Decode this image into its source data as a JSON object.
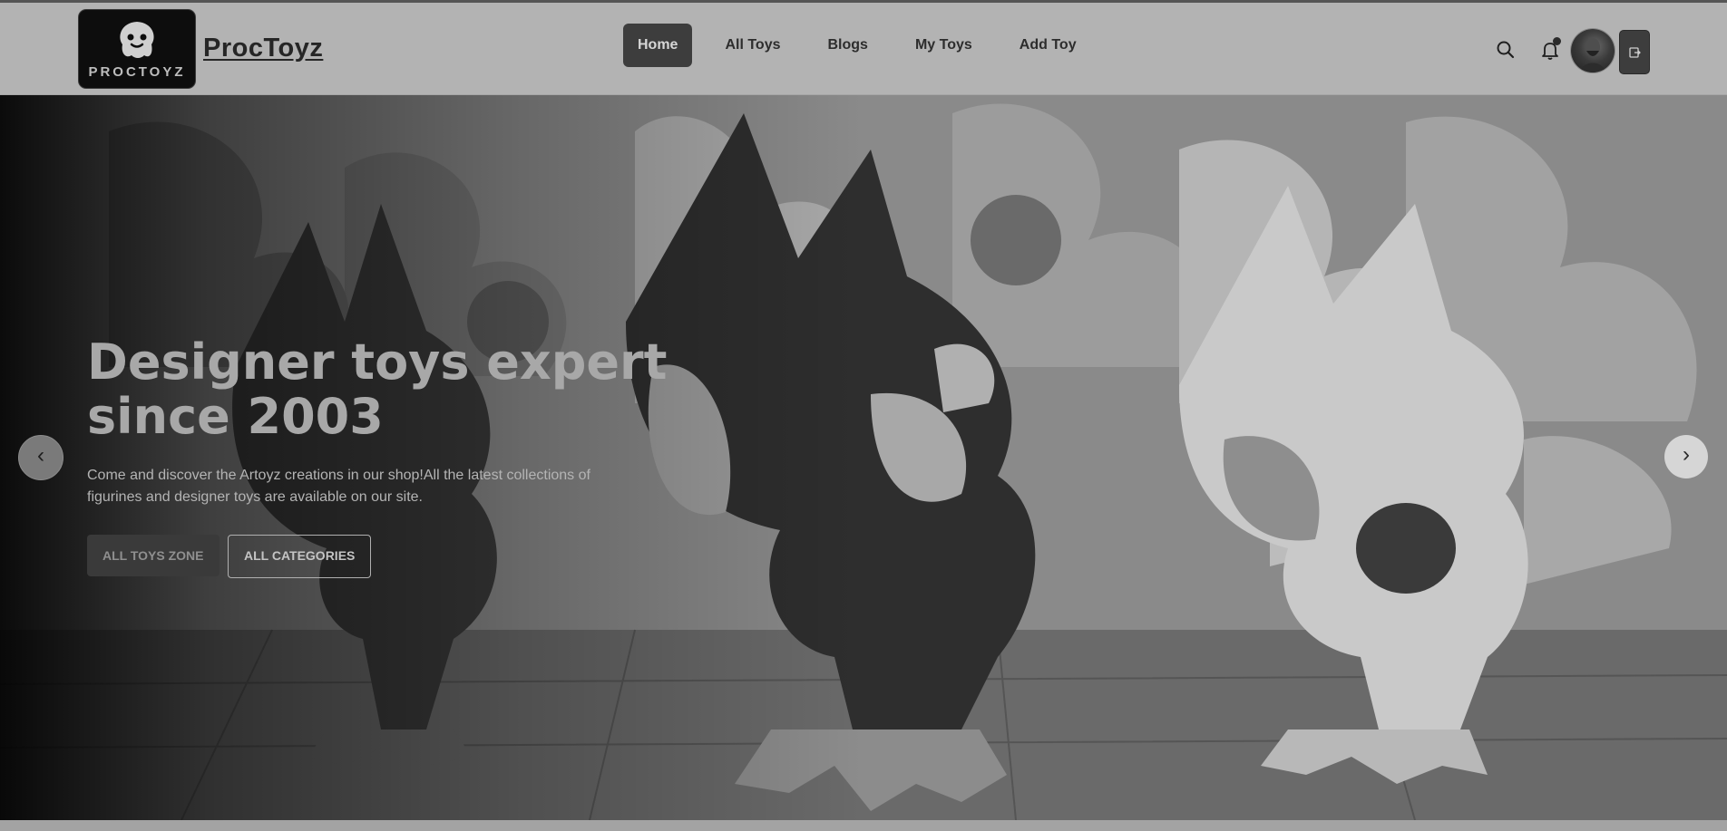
{
  "brand": {
    "logo_text": "PROCTOYZ",
    "name": "ProcToyz"
  },
  "nav": {
    "items": [
      {
        "label": "Home",
        "active": true
      },
      {
        "label": "All Toys",
        "active": false
      },
      {
        "label": "Blogs",
        "active": false
      },
      {
        "label": "My Toys",
        "active": false
      },
      {
        "label": "Add Toy",
        "active": false
      }
    ]
  },
  "icons": {
    "search": "search-icon",
    "notifications": "bell-icon",
    "logout": "logout-icon",
    "carousel_prev": "chevron-left-icon",
    "carousel_next": "chevron-right-icon"
  },
  "hero": {
    "title_line1": "Designer toys expert",
    "title_line2": "since 2003",
    "description": "Come and discover the Artoyz creations in our shop!All the latest collections of figurines and designer toys are available on our site.",
    "primary_button": "ALL TOYS ZONE",
    "secondary_button": "ALL CATEGORIES",
    "prev_arrow": "‹",
    "next_arrow": "›"
  },
  "colors": {
    "navbar_bg": "#b3b3b3",
    "active_nav_bg": "#3d3d3d",
    "logo_bg": "#0d0d0d"
  }
}
